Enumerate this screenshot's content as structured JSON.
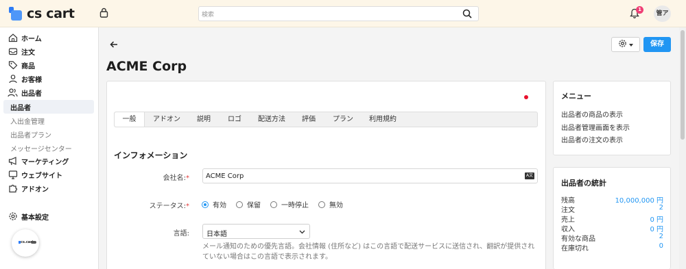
{
  "app": {
    "logo_text": "cs cart",
    "mini_logo_text": "cs.cart"
  },
  "header": {
    "search_placeholder": "検索",
    "notification_count": "1",
    "avatar_initials": "管ア"
  },
  "sidebar": {
    "items": [
      {
        "label": "ホーム",
        "icon": "home-icon"
      },
      {
        "label": "注文",
        "icon": "inbox-icon"
      },
      {
        "label": "商品",
        "icon": "tag-icon"
      },
      {
        "label": "お客様",
        "icon": "user-icon"
      },
      {
        "label": "出品者",
        "icon": "users-icon"
      }
    ],
    "active_item": "出品者",
    "sub_items": [
      "入出金管理",
      "出品者プラン",
      "メッセージセンター"
    ],
    "items2": [
      {
        "label": "マーケティング",
        "icon": "megaphone-icon"
      },
      {
        "label": "ウェブサイト",
        "icon": "monitor-icon"
      },
      {
        "label": "アドオン",
        "icon": "puzzle-icon"
      }
    ],
    "settings_label": "基本設定"
  },
  "page": {
    "title": "ACME Corp",
    "save_label": "保存"
  },
  "tabs": [
    "一般",
    "アドオン",
    "説明",
    "ロゴ",
    "配送方法",
    "評価",
    "プラン",
    "利用規約"
  ],
  "form": {
    "section_title": "インフォメーション",
    "company_label": "会社名:",
    "company_value": "ACME Corp",
    "status_label": "ステータス:",
    "status_options": [
      "有効",
      "保留",
      "一時停止",
      "無効"
    ],
    "status_selected": "有効",
    "language_label": "言語:",
    "language_value": "日本語",
    "language_help": "メール通知のための優先言語。会社情報 (住所など) はこの言語で配送サービスに送信され、翻訳が提供されていない場合はこの言語で表示されます。"
  },
  "menu_panel": {
    "title": "メニュー",
    "links": [
      "出品者の商品の表示",
      "出品者管理画面を表示",
      "出品者の注文の表示"
    ]
  },
  "stats_panel": {
    "title": "出品者の統計",
    "rows": [
      {
        "label": "残高",
        "value": "10,000,000 円"
      },
      {
        "label": "注文",
        "value": "2"
      },
      {
        "label": "売上",
        "value": "0 円"
      },
      {
        "label": "収入",
        "value": "0 円"
      },
      {
        "label": "有効な商品",
        "value": "2"
      },
      {
        "label": "在庫切れ",
        "value": "0"
      }
    ]
  },
  "colors": {
    "accent": "#2196f3",
    "header_bg": "#fdf6e8",
    "badge": "#ef3e74",
    "required": "#e23a3a"
  }
}
